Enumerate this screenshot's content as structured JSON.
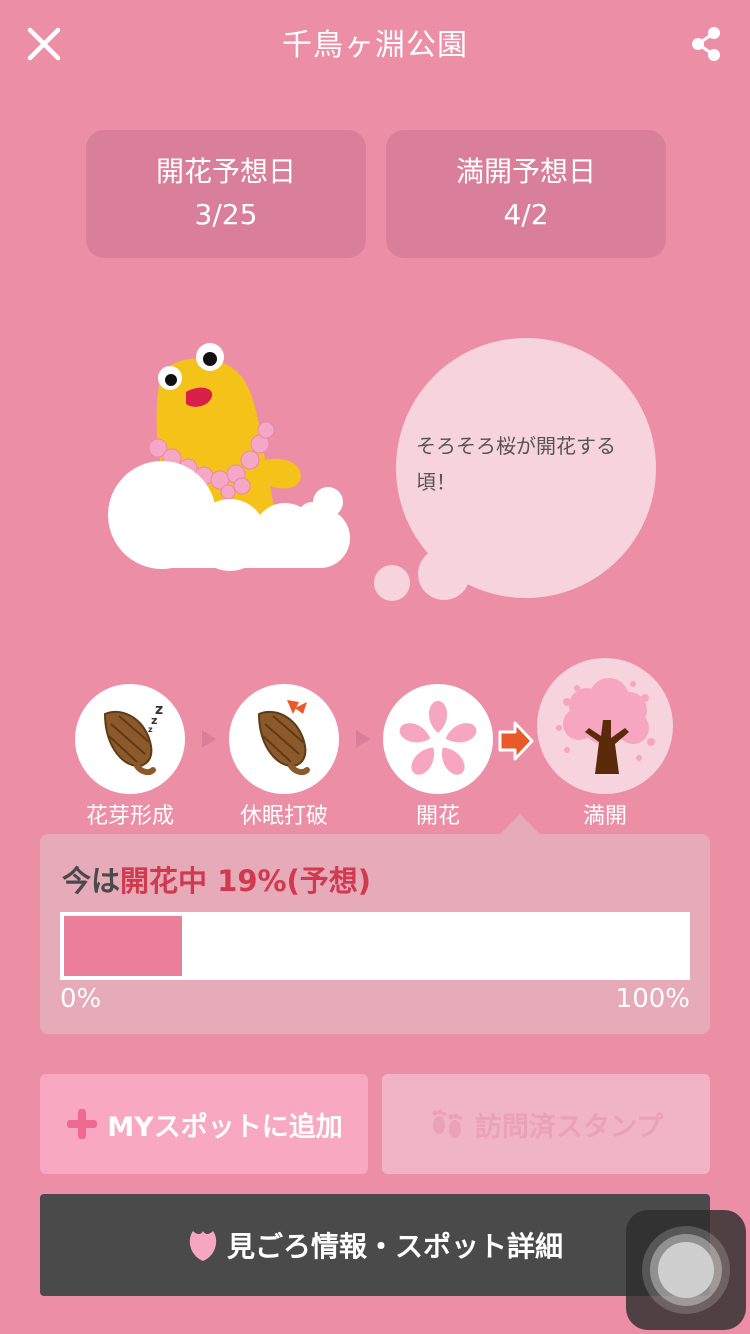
{
  "header": {
    "title": "千鳥ヶ淵公園",
    "close_icon": "close-icon",
    "share_icon": "share-icon"
  },
  "forecast": {
    "bloom": {
      "label": "開花予想日",
      "value": "3/25"
    },
    "full": {
      "label": "満開予想日",
      "value": "4/2"
    }
  },
  "bubble": {
    "text": "そろそろ桜が開花する頃！"
  },
  "stages": [
    {
      "label": "花芽形成",
      "icon": "sleeping-bud-icon"
    },
    {
      "label": "休眠打破",
      "icon": "awakening-bud-icon"
    },
    {
      "label": "開花",
      "icon": "sakura-flower-icon"
    },
    {
      "label": "満開",
      "icon": "full-bloom-tree-icon"
    }
  ],
  "progress": {
    "prefix": "今は",
    "stage": "開花中",
    "value": "19%(予想)",
    "percent": 19,
    "min_label": "0%",
    "max_label": "100%"
  },
  "buttons": {
    "my_spot": "MYスポットに追加",
    "visited": "訪問済スタンプ",
    "detail": "見ごろ情報・スポット詳細"
  },
  "colors": {
    "background": "#ec8ea6",
    "accent_red": "#d0394e",
    "progress_fill": "#ec7f9c",
    "dark_button": "#4a4a4a"
  }
}
